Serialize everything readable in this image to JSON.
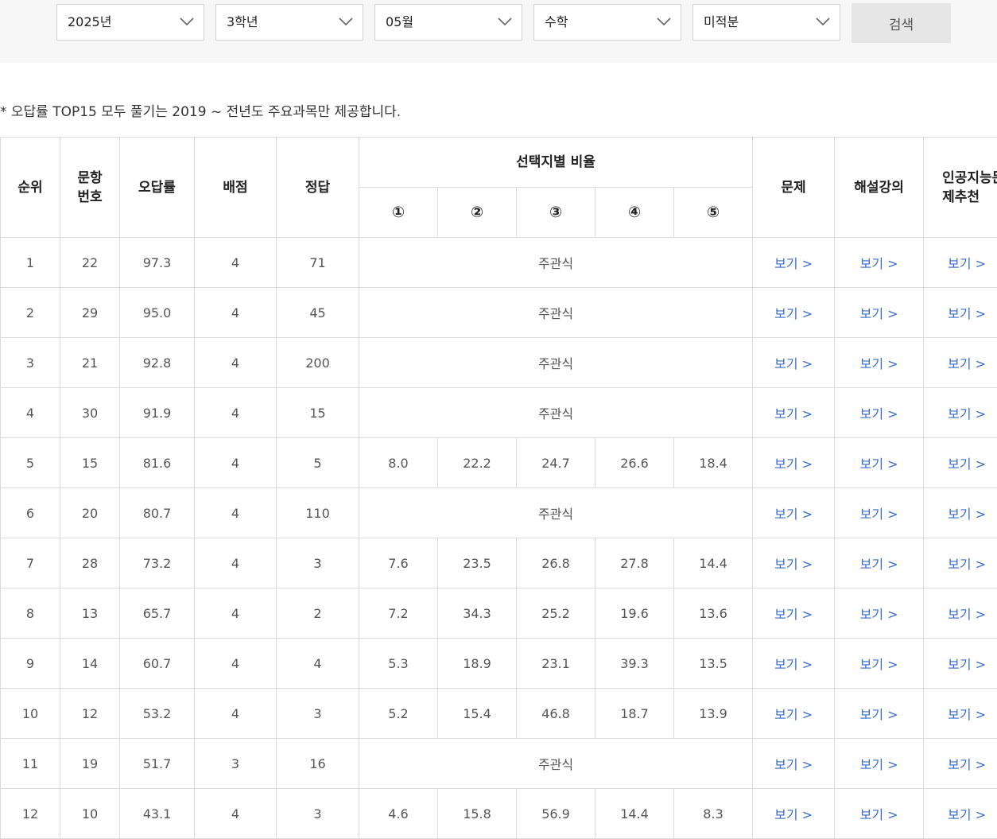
{
  "filters": {
    "year": "2025년",
    "grade": "3학년",
    "month": "05월",
    "subject": "수학",
    "elective": "미적분",
    "search_label": "검색"
  },
  "notice": "* 오답률 TOP15 모두 풀기는 2019 ~ 전년도 주요과목만 제공합니다.",
  "table": {
    "headers": {
      "rank": "순위",
      "item_no": "문항번호",
      "error_rate": "오답률",
      "points": "배점",
      "answer": "정답",
      "choice_ratio": "선택지별 비율",
      "choices": [
        "①",
        "②",
        "③",
        "④",
        "⑤"
      ],
      "problem": "문제",
      "lecture": "해설강의",
      "ai": "인공지능문제추천"
    },
    "subjective_label": "주관식",
    "view_label": "보기 >",
    "rows": [
      {
        "rank": "1",
        "no": "22",
        "rate": "97.3",
        "pts": "4",
        "ans": "71",
        "choices": null
      },
      {
        "rank": "2",
        "no": "29",
        "rate": "95.0",
        "pts": "4",
        "ans": "45",
        "choices": null
      },
      {
        "rank": "3",
        "no": "21",
        "rate": "92.8",
        "pts": "4",
        "ans": "200",
        "choices": null
      },
      {
        "rank": "4",
        "no": "30",
        "rate": "91.9",
        "pts": "4",
        "ans": "15",
        "choices": null
      },
      {
        "rank": "5",
        "no": "15",
        "rate": "81.6",
        "pts": "4",
        "ans": "5",
        "choices": [
          "8.0",
          "22.2",
          "24.7",
          "26.6",
          "18.4"
        ]
      },
      {
        "rank": "6",
        "no": "20",
        "rate": "80.7",
        "pts": "4",
        "ans": "110",
        "choices": null
      },
      {
        "rank": "7",
        "no": "28",
        "rate": "73.2",
        "pts": "4",
        "ans": "3",
        "choices": [
          "7.6",
          "23.5",
          "26.8",
          "27.8",
          "14.4"
        ]
      },
      {
        "rank": "8",
        "no": "13",
        "rate": "65.7",
        "pts": "4",
        "ans": "2",
        "choices": [
          "7.2",
          "34.3",
          "25.2",
          "19.6",
          "13.6"
        ]
      },
      {
        "rank": "9",
        "no": "14",
        "rate": "60.7",
        "pts": "4",
        "ans": "4",
        "choices": [
          "5.3",
          "18.9",
          "23.1",
          "39.3",
          "13.5"
        ]
      },
      {
        "rank": "10",
        "no": "12",
        "rate": "53.2",
        "pts": "4",
        "ans": "3",
        "choices": [
          "5.2",
          "15.4",
          "46.8",
          "18.7",
          "13.9"
        ]
      },
      {
        "rank": "11",
        "no": "19",
        "rate": "51.7",
        "pts": "3",
        "ans": "16",
        "choices": null
      },
      {
        "rank": "12",
        "no": "10",
        "rate": "43.1",
        "pts": "4",
        "ans": "3",
        "choices": [
          "4.6",
          "15.8",
          "56.9",
          "14.4",
          "8.3"
        ]
      }
    ]
  }
}
